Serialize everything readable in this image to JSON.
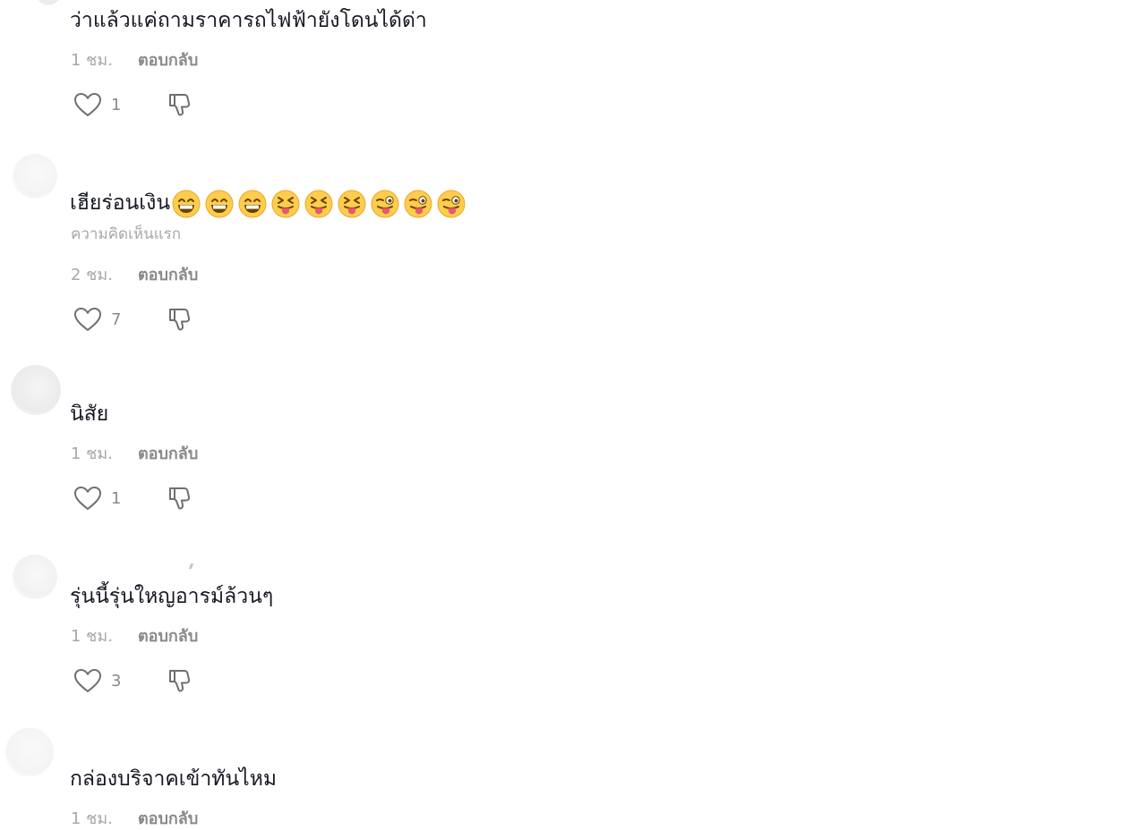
{
  "comments": [
    {
      "text": "ว่าแล้วแค่ถามราคารถไฟฟ้ายังโดนได้ด่า",
      "time": "1 ชม.",
      "reply_label": "ตอบกลับ",
      "likes": "1"
    },
    {
      "text": "เฮียร่อนเงิน",
      "emojis": [
        "grinning-face-icon",
        "grinning-face-icon",
        "grinning-face-icon",
        "squinting-tongue-face-icon",
        "squinting-tongue-face-icon",
        "squinting-tongue-face-icon",
        "winking-tongue-face-icon",
        "winking-tongue-face-icon",
        "winking-tongue-face-icon"
      ],
      "badge": "ความคิดเห็นแรก",
      "time": "2 ชม.",
      "reply_label": "ตอบกลับ",
      "likes": "7"
    },
    {
      "text": "นิสัย",
      "time": "1 ชม.",
      "reply_label": "ตอบกลับ",
      "likes": "1"
    },
    {
      "text": "รุ่นนี้รุ่นใหญอารม์ล้วนๆ",
      "time": "1 ชม.",
      "reply_label": "ตอบกลับ",
      "likes": "3"
    },
    {
      "text": "กล่องบริจาคเข้าทันไหม",
      "time": "1 ชม.",
      "reply_label": "ตอบกลับ"
    }
  ],
  "colors": {
    "text": "#161823",
    "muted": "#a8a8a8",
    "reply": "#8a8a8a",
    "icon": "#6f6f6f"
  },
  "icons": {
    "like": "heart-outline-icon",
    "dislike": "thumbs-down-outline-icon"
  }
}
